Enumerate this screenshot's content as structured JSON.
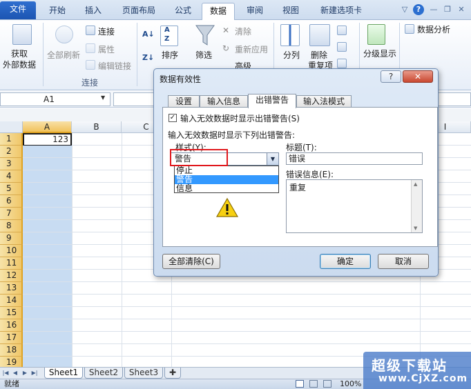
{
  "ribbon_tabs": [
    "文件",
    "开始",
    "插入",
    "页面布局",
    "公式",
    "数据",
    "审阅",
    "视图",
    "新建选项卡"
  ],
  "active_tab": "数据",
  "ribbon": {
    "get_external_line1": "获取",
    "get_external_line2": "外部数据",
    "refresh_all": "全部刷新",
    "connections": "连接",
    "properties": "属性",
    "edit_links": "编辑链接",
    "group_connections": "连接",
    "sort": "排序",
    "filter": "筛选",
    "clear": "清除",
    "reapply": "重新应用",
    "advanced": "高级",
    "text_to_columns": "分列",
    "remove_duplicates": "删除",
    "remove_duplicates_sub": "重复项",
    "outline": "分级显示",
    "data_analysis": "数据分析",
    "sort_az_top": "A",
    "sort_az_bottom": "Z"
  },
  "name_box": "A1",
  "columns": [
    "A",
    "B",
    "C",
    "I"
  ],
  "rows": [
    "1",
    "2",
    "3",
    "4",
    "5",
    "6",
    "7",
    "8",
    "9",
    "10",
    "11",
    "12",
    "13",
    "14",
    "15",
    "16",
    "17",
    "18",
    "19"
  ],
  "cell_a1_value": "123",
  "sheet_tabs": [
    "Sheet1",
    "Sheet2",
    "Sheet3"
  ],
  "status": {
    "ready": "就绪",
    "zoom": "100%"
  },
  "dialog": {
    "title": "数据有效性",
    "help": "?",
    "close": "✕",
    "tabs": [
      "设置",
      "输入信息",
      "出错警告",
      "输入法模式"
    ],
    "active_tab": "出错警告",
    "show_alert_checkbox_label": "输入无效数据时显示出错警告(S)",
    "show_alert_checked": true,
    "section_heading": "输入无效数据时显示下列出错警告:",
    "style_label": "样式(Y):",
    "style_value": "警告",
    "style_options": [
      "停止",
      "警告",
      "信息"
    ],
    "style_selected": "警告",
    "title_label": "标题(T):",
    "title_value": "错误",
    "message_label": "错误信息(E):",
    "message_value": "重复",
    "clear_all_button": "全部清除(C)",
    "ok_button": "确定",
    "cancel_button": "取消"
  },
  "watermark": {
    "line1": "超级下载站",
    "line2": "www.CjXZ.com"
  },
  "colors": {
    "file_tab": "#1c55b2",
    "selection_blue": "#3399ff",
    "highlight_red": "#e0171c",
    "warning_yellow": "#f7d012"
  }
}
